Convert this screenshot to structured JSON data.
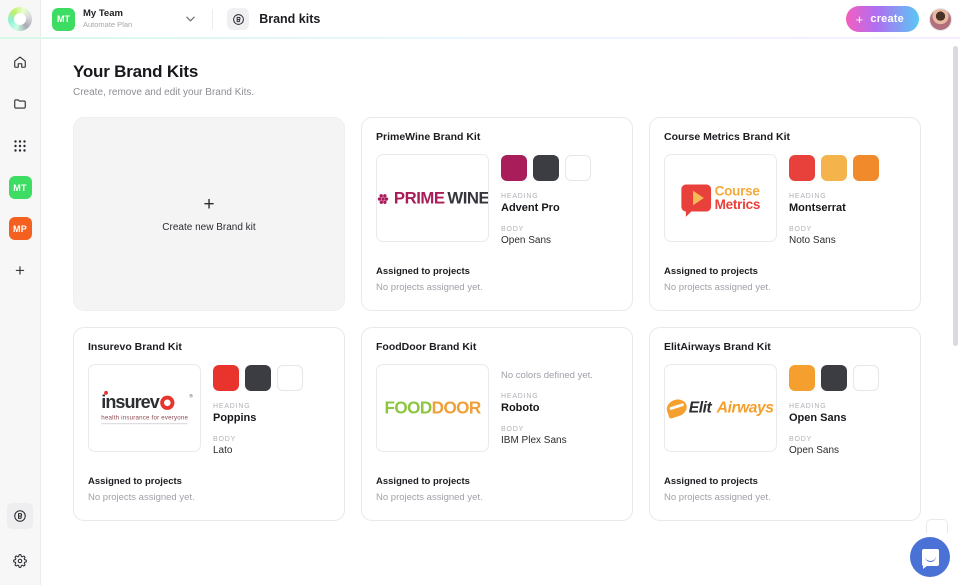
{
  "topbar": {
    "logo_icon": "circular-gradient-logo",
    "team_initials": "MT",
    "team_name": "My Team",
    "team_plan": "Automate Plan",
    "caret_icon": "chevron-down-icon",
    "page_icon": "brand-kit-icon",
    "page_title": "Brand kits",
    "create_label": "create",
    "create_plus": "+",
    "avatar_icon": "user-avatar"
  },
  "rail": {
    "items": [
      {
        "name": "home-icon",
        "label": "Home"
      },
      {
        "name": "folder-icon",
        "label": "Projects"
      },
      {
        "name": "apps-grid-icon",
        "label": "Apps"
      },
      {
        "name": "team-mt",
        "label": "MT"
      },
      {
        "name": "team-mp",
        "label": "MP"
      },
      {
        "name": "add-team-icon",
        "label": "+"
      }
    ],
    "bottom": [
      {
        "name": "brand-kits-icon",
        "label": "Brand kits"
      },
      {
        "name": "settings-gear-icon",
        "label": "Settings"
      }
    ]
  },
  "page": {
    "title": "Your Brand Kits",
    "subtitle": "Create, remove and edit your Brand Kits."
  },
  "labels": {
    "heading_label": "HEADING",
    "body_label": "BODY",
    "assigned_title": "Assigned to projects",
    "assigned_empty": "No projects assigned yet.",
    "no_colors": "No colors defined yet."
  },
  "create_card": {
    "plus": "+",
    "label": "Create new Brand kit"
  },
  "kits": [
    {
      "title": "PrimeWine Brand Kit",
      "logo": {
        "name": "primewine-logo",
        "part1": "PRIME",
        "part2": "WINE"
      },
      "colors": [
        "#A81D5A",
        "#3C3D42",
        "#FFFFFF"
      ],
      "no_colors": false,
      "heading_font": "Advent Pro",
      "body_font": "Open Sans",
      "assigned_title": "Assigned to projects",
      "assigned_text": "No projects assigned yet."
    },
    {
      "title": "Course Metrics Brand Kit",
      "logo": {
        "name": "course-metrics-logo",
        "part1": "Course",
        "part2": "Metrics"
      },
      "colors": [
        "#E8403A",
        "#F5B34C",
        "#F08A2A"
      ],
      "no_colors": false,
      "heading_font": "Montserrat",
      "body_font": "Noto Sans",
      "assigned_title": "Assigned to projects",
      "assigned_text": "No projects assigned yet."
    },
    {
      "title": "Insurevo Brand Kit",
      "logo": {
        "name": "insurevo-logo",
        "part1": "insurev",
        "part2": "health insurance for everyone"
      },
      "colors": [
        "#E8342C",
        "#3C3D42",
        "#FFFFFF"
      ],
      "no_colors": false,
      "heading_font": "Poppins",
      "body_font": "Lato",
      "assigned_title": "Assigned to projects",
      "assigned_text": "No projects assigned yet."
    },
    {
      "title": "FoodDoor Brand Kit",
      "logo": {
        "name": "fooddoor-logo",
        "part1": "FOOD",
        "part2": "DOOR"
      },
      "colors": [],
      "no_colors": true,
      "heading_font": "Roboto",
      "body_font": "IBM Plex Sans",
      "assigned_title": "Assigned to projects",
      "assigned_text": "No projects assigned yet."
    },
    {
      "title": "ElitAirways Brand Kit",
      "logo": {
        "name": "elitairways-logo",
        "part1": "Elit",
        "part2": "Airways"
      },
      "colors": [
        "#F5A02E",
        "#3C3D42",
        "#FFFFFF"
      ],
      "no_colors": false,
      "heading_font": "Open Sans",
      "body_font": "Open Sans",
      "assigned_title": "Assigned to projects",
      "assigned_text": "No projects assigned yet."
    }
  ],
  "chat": {
    "icon": "chat-bubble-icon"
  }
}
